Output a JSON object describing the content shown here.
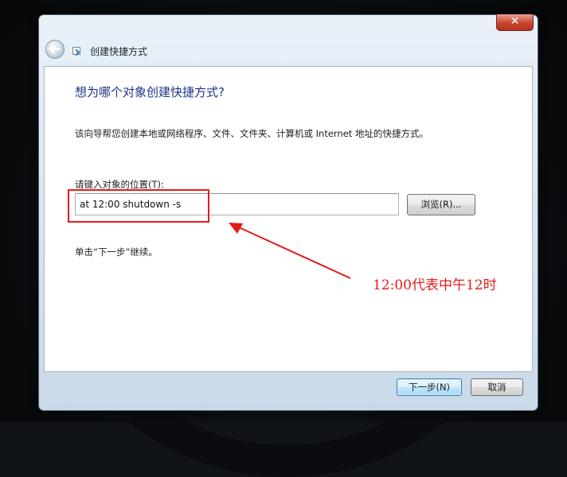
{
  "window": {
    "title": "创建快捷方式",
    "close_label": "✕"
  },
  "wizard": {
    "heading": "想为哪个对象创建快捷方式?",
    "description": "该向导帮您创建本地或网络程序、文件、文件夹、计算机或 Internet 地址的快捷方式。",
    "location_label": "请键入对象的位置(T):",
    "location_value": "at 12:00 shutdown -s",
    "browse_label": "浏览(R)...",
    "instruction": "单击“下一步”继续。"
  },
  "footer": {
    "next_label": "下一步(N)",
    "cancel_label": "取消"
  },
  "annotation": {
    "text": "12:00代表中午12时",
    "color": "#e31b1b"
  },
  "icons": {
    "back": "back-arrow-icon",
    "shortcut": "shortcut-icon",
    "close": "close-icon"
  }
}
